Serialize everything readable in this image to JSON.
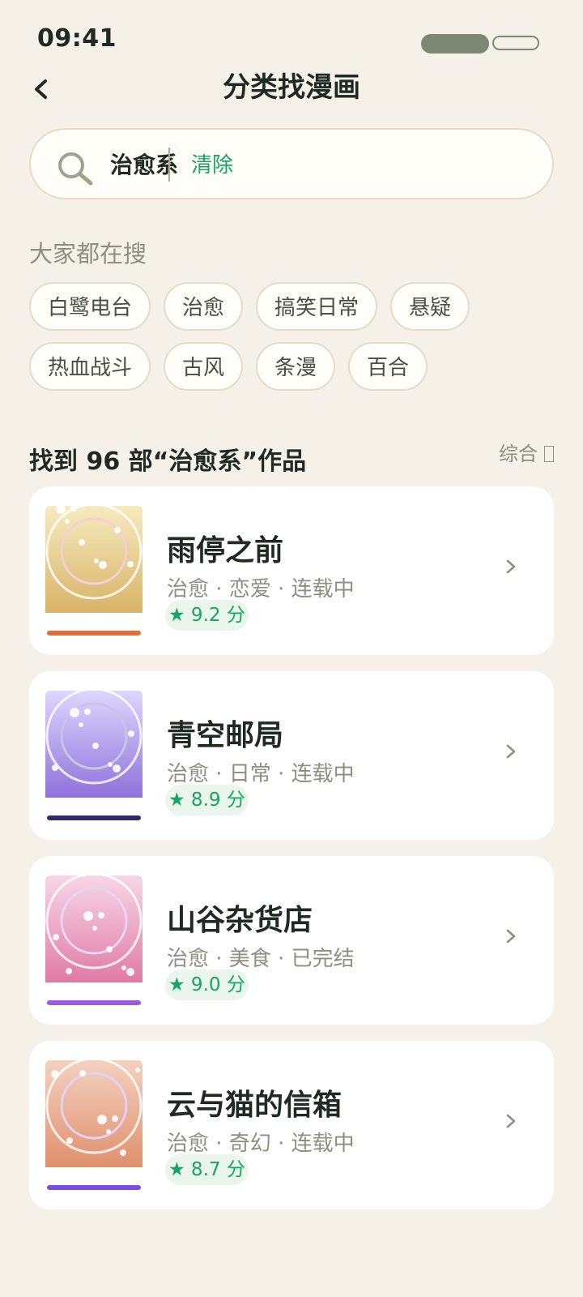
{
  "status": {
    "time": "09:41"
  },
  "header": {
    "title": "分类找漫画"
  },
  "search": {
    "value": "治愈系",
    "clear_label": "清除"
  },
  "hot": {
    "title": "大家都在搜",
    "chips": [
      "白鹭电台",
      "治愈",
      "搞笑日常",
      "悬疑",
      "热血战斗",
      "古风",
      "条漫",
      "百合"
    ]
  },
  "results": {
    "summary": "找到 96 部“治愈系”作品",
    "sort_label": "综合",
    "items": [
      {
        "title": "雨停之前",
        "tags": "治愈 · 恋爱 · 连载中",
        "rating": "★ 9.2 分",
        "cover": {
          "top": "#f6ebbf",
          "bottom": "#d8b366",
          "band": "#e06d3c",
          "ring": "#f4cfd6"
        }
      },
      {
        "title": "青空邮局",
        "tags": "治愈 · 日常 · 连载中",
        "rating": "★ 8.9 分",
        "cover": {
          "top": "#ddd6ff",
          "bottom": "#8e72da",
          "band": "#2e2a6b",
          "ring": "#c8c4e4"
        }
      },
      {
        "title": "山谷杂货店",
        "tags": "治愈 · 美食 · 已完结",
        "rating": "★ 9.0 分",
        "cover": {
          "top": "#f7d7e6",
          "bottom": "#e07aa5",
          "band": "#9a5ae2",
          "ring": "#e7d4ee"
        }
      },
      {
        "title": "云与猫的信箱",
        "tags": "治愈 · 奇幻 · 连载中",
        "rating": "★ 8.7 分",
        "cover": {
          "top": "#f3d1bf",
          "bottom": "#e0906d",
          "band": "#7c4be0",
          "ring": "#e3d1f2"
        }
      }
    ]
  },
  "colors": {
    "background": "#f5f1e9",
    "accent": "#18a36a",
    "card": "#ffffff"
  },
  "icons": {
    "back": "chevron-left-icon",
    "search": "search-icon",
    "sort": "sort-icon",
    "row": "chevron-right-icon"
  }
}
